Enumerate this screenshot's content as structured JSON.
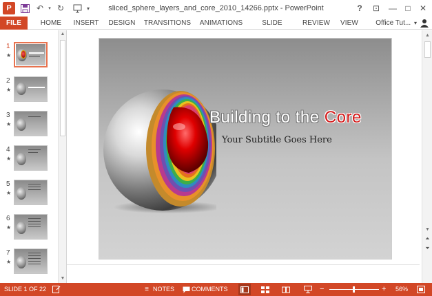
{
  "window": {
    "title": "sliced_sphere_layers_and_core_2010_14266.pptx - PowerPoint",
    "app_logo_text": "P",
    "controls": {
      "help": "?",
      "ribbon_display": "⊡",
      "minimize": "—",
      "maximize": "□",
      "close": "✕"
    }
  },
  "qat": {
    "save_icon": "save-icon",
    "undo_icon": "undo-icon",
    "redo_icon": "redo-icon",
    "present_icon": "present-icon",
    "customize_icon": "customize-icon"
  },
  "ribbon": {
    "tabs": [
      "FILE",
      "HOME",
      "INSERT",
      "DESIGN",
      "TRANSITIONS",
      "ANIMATIONS",
      "SLIDE SHOW",
      "REVIEW",
      "VIEW"
    ],
    "account": "Office Tut...",
    "account_chevron": "▾"
  },
  "thumbnails": [
    {
      "number": "1",
      "star": "★",
      "active": true
    },
    {
      "number": "2",
      "star": "★",
      "active": false
    },
    {
      "number": "3",
      "star": "★",
      "active": false
    },
    {
      "number": "4",
      "star": "★",
      "active": false
    },
    {
      "number": "5",
      "star": "★",
      "active": false
    },
    {
      "number": "6",
      "star": "★",
      "active": false
    },
    {
      "number": "7",
      "star": "★",
      "active": false
    }
  ],
  "slide": {
    "title_main": "Building to the ",
    "title_accent": "Core",
    "subtitle": "Your Subtitle Goes Here",
    "accent_color": "#d41c1c"
  },
  "scroll": {
    "up": "▲",
    "down": "▼",
    "prev_slide": "⏶",
    "next_slide": "⏷"
  },
  "statusbar": {
    "slide_indicator": "SLIDE 1 OF 22",
    "notes_label": "NOTES",
    "comments_label": "COMMENTS",
    "zoom_minus": "−",
    "zoom_plus": "+",
    "zoom_level": "56%",
    "brand_color": "#d24726"
  }
}
